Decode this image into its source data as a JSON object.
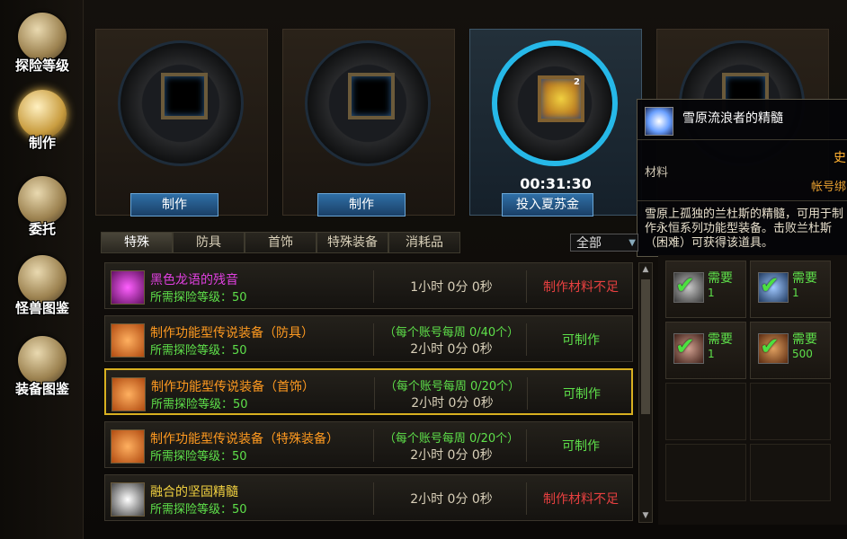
{
  "nav": {
    "items": [
      {
        "label": "探险等级",
        "icon": "map-scroll-icon"
      },
      {
        "label": "制作",
        "icon": "anvil-icon"
      },
      {
        "label": "委托",
        "icon": "envelope-icon"
      },
      {
        "label": "怪兽图鉴",
        "icon": "monster-book-icon"
      },
      {
        "label": "装备图鉴",
        "icon": "armor-book-icon"
      }
    ],
    "selected": 1
  },
  "slots": [
    {
      "button": "制作",
      "state": "empty"
    },
    {
      "button": "制作",
      "state": "empty"
    },
    {
      "button": "投入夏苏金",
      "state": "crafting",
      "timer": "00:31:30",
      "item_count": "2"
    },
    {
      "button": "",
      "state": "empty"
    }
  ],
  "tooltip": {
    "title": "雪原流浪者的精髓",
    "rarity": "史",
    "type": "材料",
    "bind": "帐号绑",
    "desc": "雪原上孤独的兰杜斯的精髓，可用于制作永恒系列功能型装备。击败兰杜斯（困难）可获得该道具。"
  },
  "tabs": [
    "特殊",
    "防具",
    "首饰",
    "特殊装备",
    "消耗品"
  ],
  "selected_tab": 0,
  "filter": "全部",
  "recipes": [
    {
      "name": "黑色龙语的残音",
      "name_color": "#e040e0",
      "level_label": "所需探险等级：",
      "level": "50",
      "limit": "",
      "time": "1小时 0分 0秒",
      "status": "制作材料不足",
      "status_color": "#e84040"
    },
    {
      "name": "制作功能型传说装备（防具）",
      "name_color": "#ff9a20",
      "level_label": "所需探险等级：",
      "level": "50",
      "limit": "（每个账号每周 0/40个）",
      "time": "2小时 0分 0秒",
      "status": "可制作",
      "status_color": "#5ee04a"
    },
    {
      "name": "制作功能型传说装备（首饰）",
      "name_color": "#ff9a20",
      "level_label": "所需探险等级：",
      "level": "50",
      "limit": "（每个账号每周 0/20个）",
      "time": "2小时 0分 0秒",
      "status": "可制作",
      "status_color": "#5ee04a"
    },
    {
      "name": "制作功能型传说装备（特殊装备）",
      "name_color": "#ff9a20",
      "level_label": "所需探险等级：",
      "level": "50",
      "limit": "（每个账号每周 0/20个）",
      "time": "2小时 0分 0秒",
      "status": "可制作",
      "status_color": "#5ee04a"
    },
    {
      "name": "融合的坚固精髓",
      "name_color": "#f0d040",
      "level_label": "所需探险等级：",
      "level": "50",
      "limit": "",
      "time": "2小时 0分 0秒",
      "status": "制作材料不足",
      "status_color": "#e84040"
    }
  ],
  "selected_recipe": 2,
  "materials": [
    {
      "req": "需要",
      "num": "1"
    },
    {
      "req": "需要",
      "num": "1"
    },
    {
      "req": "需要",
      "num": "1"
    },
    {
      "req": "需要",
      "num": "500"
    }
  ]
}
